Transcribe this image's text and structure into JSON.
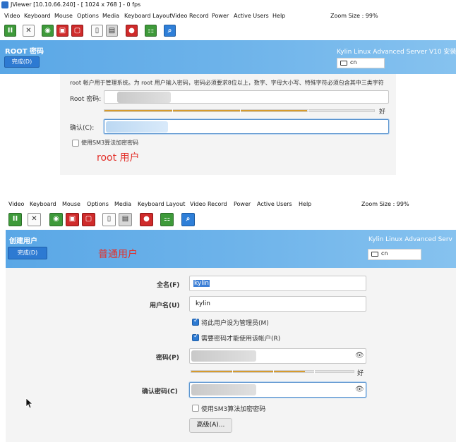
{
  "window": {
    "title": "JViewer [10.10.66.240] - [ 1024 x 768 ] - 0 fps"
  },
  "menu": {
    "items": [
      "Video",
      "Keyboard",
      "Mouse",
      "Options",
      "Media",
      "Keyboard Layout",
      "Video Record",
      "Power",
      "Active Users",
      "Help"
    ],
    "zoom": "Zoom Size : 99%"
  },
  "toolbar": {
    "icons": [
      "pause-icon",
      "fullscreen-icon",
      "cd-icon",
      "floppy-icon",
      "hard-disk-icon",
      "clipboard-icon",
      "keyboard-icon",
      "record-icon",
      "power-icon",
      "zoom-icon"
    ]
  },
  "root_screen": {
    "header_title": "ROOT 密码",
    "done_label": "完成(D)",
    "product": "Kylin Linux Advanced Server V10 安装",
    "kb_layout": "cn",
    "description": "root 帐户用于管理系统。为 root 用户输入密码，密码必须要求8位以上，数字、字母大小写、特殊字符必须包含其中三类字符",
    "password_label": "Root 密码:",
    "strength_label": "好",
    "strength_fraction": 0.75,
    "confirm_label": "确认(C):",
    "sm3_label": "使用SM3算法加密密码",
    "annotation": "root 用户"
  },
  "user_screen": {
    "header_title": "创建用户",
    "done_label": "完成(D)",
    "product": "Kylin Linux Advanced Serv",
    "kb_layout": "cn",
    "annotation": "普通用户",
    "fullname_label": "全名(F)",
    "fullname_value": "kylin",
    "username_label": "用户名(U)",
    "username_value": "kylin",
    "admin_label": "将此用户设为管理员(M)",
    "admin_checked": true,
    "require_pw_label": "需要密码才能使用该帐户(R)",
    "require_pw_checked": true,
    "password_label": "密码(P)",
    "strength_label": "好",
    "strength_fraction": 0.7,
    "confirm_label": "确认密码(C)",
    "sm3_label": "使用SM3算法加密密码",
    "sm3_checked": false,
    "advanced_label": "高级(A)..."
  }
}
